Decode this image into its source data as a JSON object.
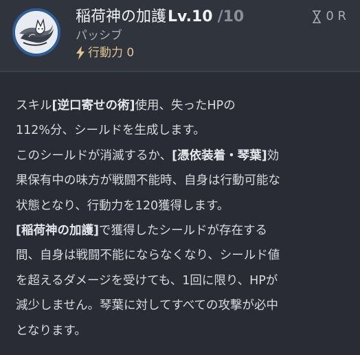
{
  "skill": {
    "name": "稲荷神の加護",
    "level_label": "Lv.10",
    "max_label": "/10",
    "type": "パッシブ",
    "action_cost": "行動力 0",
    "cooldown": "0 R"
  },
  "icons": {
    "skill": "fox-spirit-icon",
    "cooldown": "hourglass-icon",
    "action": "lightning-icon"
  },
  "colors": {
    "header_bg": "#30343d",
    "body_bg": "#292c34",
    "icon_ring": "#2e5e97",
    "action_text": "#dfc48f"
  },
  "description": [
    [
      {
        "t": "スキル"
      },
      {
        "t": "[逆口寄せの術]",
        "b": true
      },
      {
        "t": "使用、失ったHPの"
      }
    ],
    [
      {
        "t": "112%分、シールドを生成します。"
      }
    ],
    [
      {
        "t": "このシールドが消滅するか、"
      },
      {
        "t": "[憑依装着・琴葉]",
        "b": true
      },
      {
        "t": "効"
      }
    ],
    [
      {
        "t": "果保有中の味方が戦闘不能時、自身は行動可能な"
      }
    ],
    [
      {
        "t": "状態となり、行動力を120獲得します。"
      }
    ],
    [
      {
        "t": "[稲荷神の加護]",
        "b": true
      },
      {
        "t": "で獲得したシールドが存在する"
      }
    ],
    [
      {
        "t": "間、自身は戦闘不能にならなくなり、シールド値"
      }
    ],
    [
      {
        "t": "を超えるダメージを受けても、1回に限り、HPが"
      }
    ],
    [
      {
        "t": "減少しません。琴葉に対してすべての攻撃が必中"
      }
    ],
    [
      {
        "t": "となります。"
      }
    ]
  ]
}
